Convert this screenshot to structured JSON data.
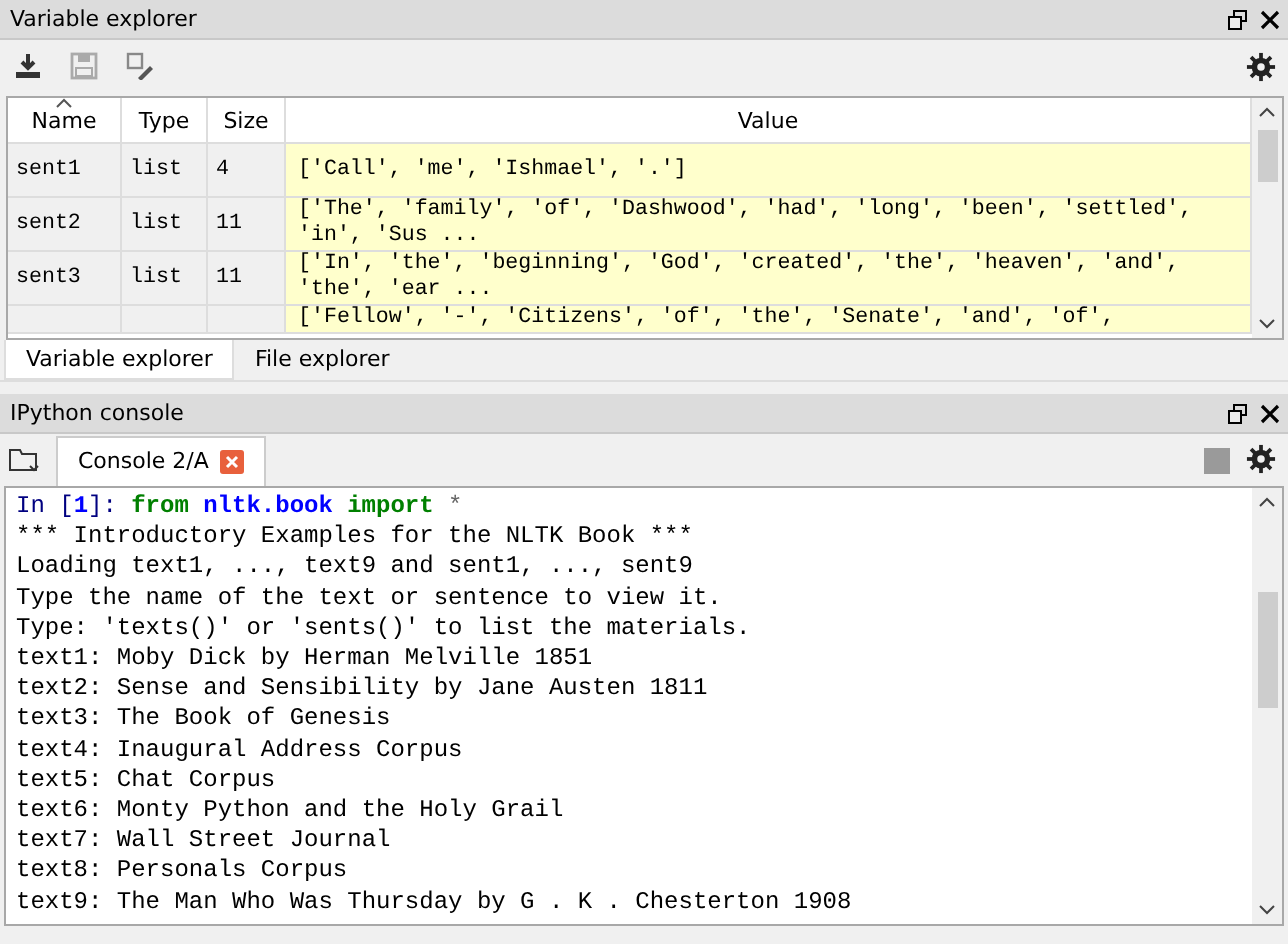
{
  "variable_explorer": {
    "title": "Variable explorer",
    "table": {
      "columns": [
        {
          "label": "Name",
          "sorted": true
        },
        {
          "label": "Type",
          "sorted": false
        },
        {
          "label": "Size",
          "sorted": false
        },
        {
          "label": "Value",
          "sorted": false
        }
      ],
      "rows": [
        {
          "name": "sent1",
          "type": "list",
          "size": "4",
          "value": "['Call', 'me', 'Ishmael', '.']"
        },
        {
          "name": "sent2",
          "type": "list",
          "size": "11",
          "value": "['The', 'family', 'of', 'Dashwood', 'had', 'long', 'been', 'settled', 'in', 'Sus ..."
        },
        {
          "name": "sent3",
          "type": "list",
          "size": "11",
          "value": "['In', 'the', 'beginning', 'God', 'created', 'the', 'heaven', 'and', 'the', 'ear ..."
        },
        {
          "value": "['Fellow', '-', 'Citizens', 'of', 'the', 'Senate', 'and', 'of',"
        }
      ]
    },
    "tabs": [
      {
        "label": "Variable explorer",
        "selected": true
      },
      {
        "label": "File explorer",
        "selected": false
      }
    ]
  },
  "console": {
    "title": "IPython console",
    "tabs": [
      {
        "label": "Console 2/A",
        "selected": true
      }
    ],
    "prompt": [
      {
        "kind": "prompt",
        "text": "In ["
      },
      {
        "kind": "number",
        "text": "1"
      },
      {
        "kind": "prompt",
        "text": "]:"
      },
      {
        "kind": "keyword",
        "text": "from"
      },
      {
        "kind": "module",
        "text": "nltk.book"
      },
      {
        "kind": "keyword",
        "text": "import"
      },
      {
        "kind": "operator",
        "text": "*"
      }
    ],
    "lines": [
      "*** Introductory Examples for the NLTK Book ***",
      "Loading text1, ..., text9 and sent1, ..., sent9",
      "Type the name of the text or sentence to view it.",
      "Type: 'texts()' or 'sents()' to list the materials.",
      "text1: Moby Dick by Herman Melville 1851",
      "text2: Sense and Sensibility by Jane Austen 1811",
      "text3: The Book of Genesis",
      "text4: Inaugural Address Corpus",
      "text5: Chat Corpus",
      "text6: Monty Python and the Holy Grail",
      "text7: Wall Street Journal",
      "text8: Personals Corpus",
      "text9: The Man Who Was Thursday by G . K . Chesterton 1908"
    ]
  }
}
